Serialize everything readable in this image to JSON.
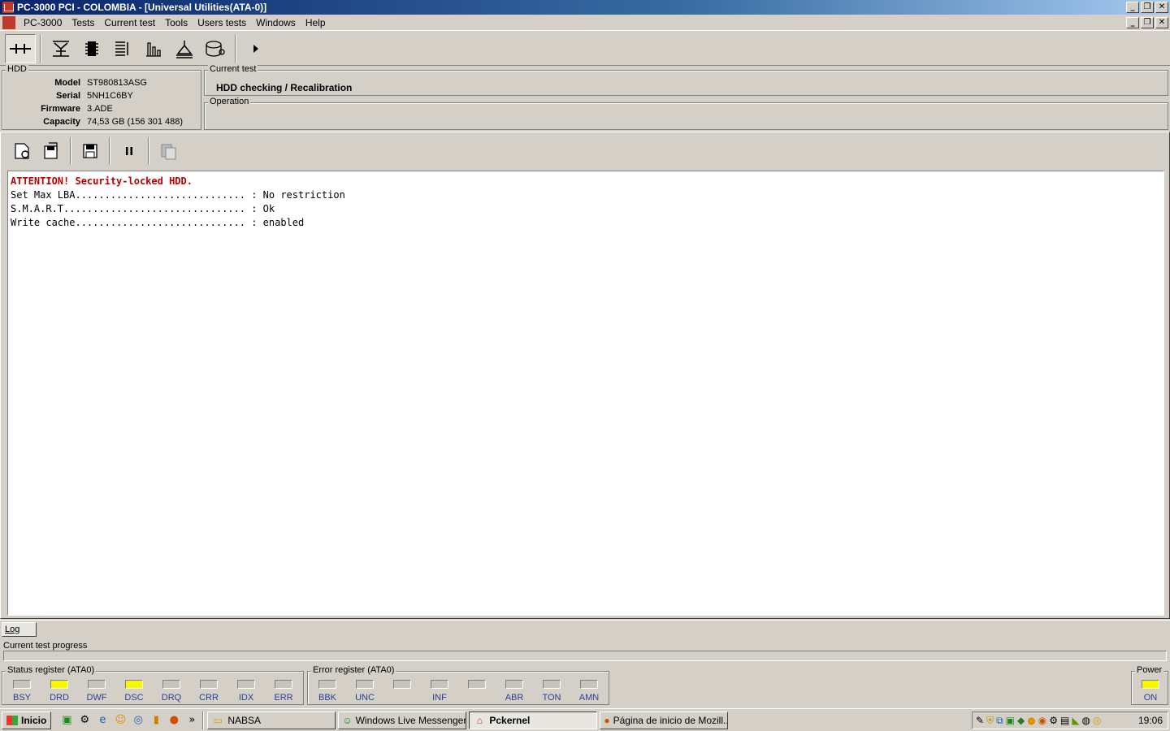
{
  "window": {
    "title": "PC-3000 PCI - COLOMBIA - [Universal Utilities(ATA-0)]",
    "controls": [
      "_",
      "❐",
      "✕"
    ]
  },
  "menu": [
    "PC-3000",
    "Tests",
    "Current test",
    "Tools",
    "Users tests",
    "Windows",
    "Help"
  ],
  "toolbar": {
    "icons": [
      "connect-icon",
      "hdd-id-icon",
      "chip-icon",
      "list-icon",
      "chart-icon",
      "head-icon",
      "disk-icon",
      "arrow-right-icon"
    ]
  },
  "hdd": {
    "label": "HDD",
    "rows": [
      {
        "key": "Model",
        "value": "ST980813ASG"
      },
      {
        "key": "Serial",
        "value": "5NH1C6BY"
      },
      {
        "key": "Firmware",
        "value": "3.ADE"
      },
      {
        "key": "Capacity",
        "value": "74,53 GB (156 301 488)"
      }
    ]
  },
  "current_test": {
    "label": "Current test",
    "value": "HDD checking / Recalibration"
  },
  "operation": {
    "label": "Operation"
  },
  "log": {
    "lines": [
      "ATTENTION! Security-locked HDD.",
      "Set Max LBA............................. : No restriction",
      "S.M.A.R.T............................... : Ok",
      "Write cache............................. : enabled"
    ]
  },
  "tabs": {
    "log": "Log"
  },
  "progress": {
    "label": "Current test progress",
    "value": 0
  },
  "status_register": {
    "label": "Status register (ATA0)",
    "bits": [
      {
        "name": "BSY",
        "on": false
      },
      {
        "name": "DRD",
        "on": true
      },
      {
        "name": "DWF",
        "on": false
      },
      {
        "name": "DSC",
        "on": true
      },
      {
        "name": "DRQ",
        "on": false
      },
      {
        "name": "CRR",
        "on": false
      },
      {
        "name": "IDX",
        "on": false
      },
      {
        "name": "ERR",
        "on": false
      }
    ]
  },
  "error_register": {
    "label": "Error register (ATA0)",
    "bits": [
      {
        "name": "BBK",
        "on": false
      },
      {
        "name": "UNC",
        "on": false
      },
      {
        "name": "",
        "on": false
      },
      {
        "name": "INF",
        "on": false
      },
      {
        "name": "",
        "on": false
      },
      {
        "name": "ABR",
        "on": false
      },
      {
        "name": "TON",
        "on": false
      },
      {
        "name": "AMN",
        "on": false
      }
    ]
  },
  "power": {
    "label": "Power",
    "state": "ON",
    "on": true
  },
  "taskbar": {
    "start": "Inicio",
    "tasks": [
      {
        "label": "NABSA",
        "active": false
      },
      {
        "label": "Windows Live Messenger",
        "active": false
      },
      {
        "label": "Pckernel",
        "active": true
      },
      {
        "label": "Página de inicio de Mozill...",
        "active": false
      }
    ],
    "clock": "19:06"
  }
}
